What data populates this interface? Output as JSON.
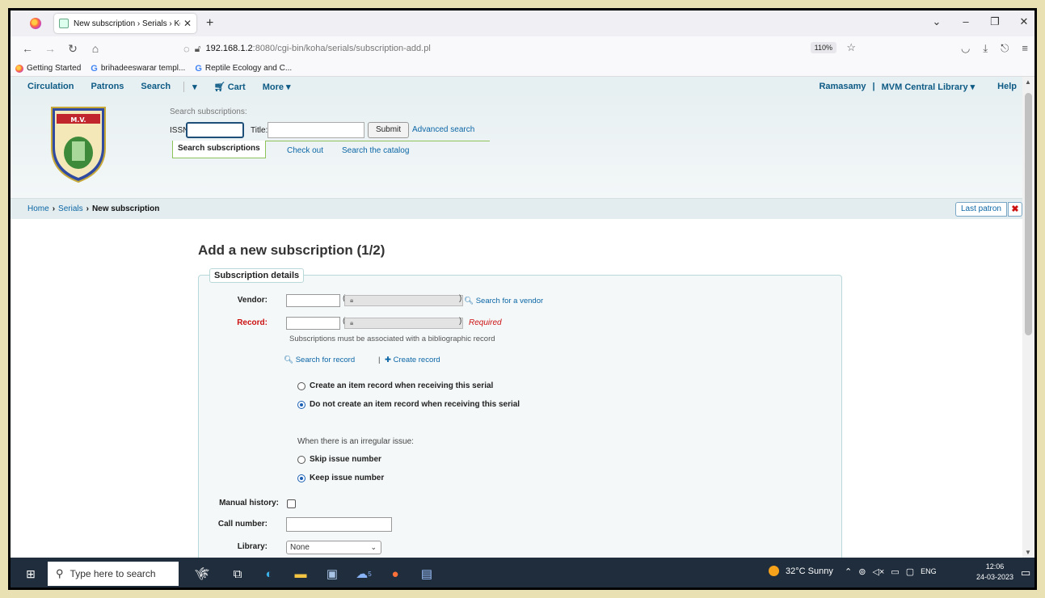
{
  "browser": {
    "tab_title": "New subscription › Serials › Koh",
    "tab_close": "✕",
    "new_tab": "+",
    "url_host": "192.168.1.2",
    "url_path": ":8080/cgi-bin/koha/serials/subscription-add.pl",
    "zoom": "110%",
    "bookmarks": [
      "Getting Started",
      "brihadeeswarar templ...",
      "Reptile Ecology and C..."
    ]
  },
  "koha_nav": {
    "items": [
      "Circulation",
      "Patrons",
      "Search",
      "▾",
      "Cart",
      "More ▾"
    ],
    "user": "Ramasamy",
    "separator": "|",
    "library": "MVM Central Library ▾",
    "help": "Help"
  },
  "search": {
    "heading": "Search subscriptions:",
    "issn_label": "ISSN:",
    "title_label": "Title:",
    "submit": "Submit",
    "advanced": "Advanced search",
    "tabs": [
      "Search subscriptions",
      "Check out",
      "Search the catalog"
    ]
  },
  "breadcrumb": {
    "home": "Home",
    "serials": "Serials",
    "current": "New subscription",
    "sep": "›"
  },
  "last_patron": "Last patron",
  "page_title": "Add a new subscription (1/2)",
  "form": {
    "legend": "Subscription details",
    "vendor_label": "Vendor:",
    "search_vendor": "Search for a vendor",
    "record_label": "Record:",
    "required": "Required",
    "record_hint": "Subscriptions must be associated with a bibliographic record",
    "search_record": "Search for record",
    "pipe": "|",
    "create_record": "Create record",
    "item_create": "Create an item record when receiving this serial",
    "item_nocreate": "Do not create an item record when receiving this serial",
    "irregular_label": "When there is an irregular issue:",
    "skip_issue": "Skip issue number",
    "keep_issue": "Keep issue number",
    "manual_history_label": "Manual history:",
    "call_number_label": "Call number:",
    "library_label": "Library:",
    "library_value": "None"
  },
  "taskbar": {
    "search_placeholder": "Type here to search",
    "weather": "32°C  Sunny",
    "lang": "ENG",
    "time": "12:06",
    "date": "24-03-2023",
    "badge": "5"
  }
}
